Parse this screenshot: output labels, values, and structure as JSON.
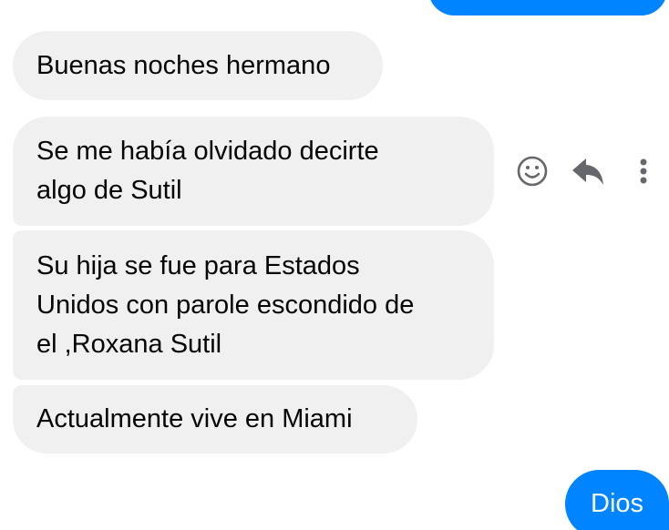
{
  "conversation": {
    "messages": [
      {
        "direction": "outgoing",
        "text": ""
      },
      {
        "direction": "incoming",
        "text": "Buenas noches hermano"
      },
      {
        "direction": "incoming",
        "text": "Se me había olvidado decirte\nalgo de Sutil"
      },
      {
        "direction": "incoming",
        "text": "Su hija se fue para Estados\nUnidos con parole escondido de\nel ,Roxana Sutil"
      },
      {
        "direction": "incoming",
        "text": "Actualmente vive en Miami"
      },
      {
        "direction": "outgoing",
        "text": "Dios"
      }
    ]
  },
  "message_actions": {
    "icons": [
      "smiley-react-icon",
      "reply-arrow-icon",
      "more-vertical-icon"
    ]
  },
  "colors": {
    "incoming_bubble": "#f0f0f0",
    "outgoing_bubble": "#0084ff",
    "icon_gray": "#65676b",
    "text_dark": "#050505"
  }
}
